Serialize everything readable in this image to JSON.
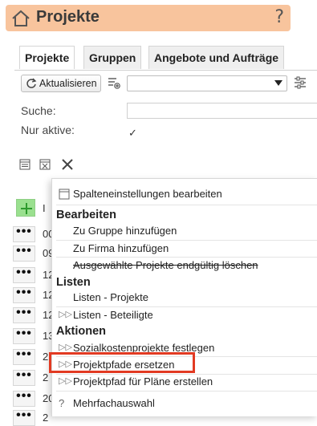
{
  "header": {
    "title": "Projekte",
    "help_glyph": "?"
  },
  "tabs": [
    {
      "label": "Projekte",
      "active": true
    },
    {
      "label": "Gruppen",
      "active": false
    },
    {
      "label": "Angebote und Aufträge",
      "active": false
    }
  ],
  "toolbar": {
    "refresh_label": "Aktualisieren",
    "select_value": ""
  },
  "filters": {
    "search_label": "Suche:",
    "search_value": "",
    "active_label": "Nur aktive:",
    "active_checked": "✓"
  },
  "list": {
    "rows": [
      {
        "dots": "•••",
        "text": "00"
      },
      {
        "dots": "•••",
        "text": "09"
      },
      {
        "dots": "•••",
        "text": "12"
      },
      {
        "dots": "•••",
        "text": "12"
      },
      {
        "dots": "•••",
        "text": "12"
      },
      {
        "dots": "•••",
        "text": "13"
      },
      {
        "dots": "•••",
        "text": "2"
      },
      {
        "dots": "•••",
        "text": "2"
      },
      {
        "dots": "•••",
        "text": "20"
      },
      {
        "dots": "•••",
        "text": "2"
      }
    ],
    "header_fragment": "I"
  },
  "menu": {
    "column_settings": "Spalteneinstellungen bearbeiten",
    "section_edit": "Bearbeiten",
    "add_to_group": "Zu Gruppe hinzufügen",
    "add_to_company": "Zu Firma hinzufügen",
    "delete_selected": "Ausgewählte Projekte endgültig löschen",
    "section_lists": "Listen",
    "list_projects": "Listen - Projekte",
    "list_participants": "Listen - Beteiligte",
    "section_actions": "Aktionen",
    "set_social_cost": "Sozialkostenprojekte festlegen",
    "replace_paths": "Projektpfade ersetzen",
    "create_plan_path": "Projektpfad für Pläne erstellen",
    "multi_select": "Mehrfachauswahl"
  },
  "colors": {
    "header_bg": "#f8c49d",
    "highlight": "#e23a22",
    "add_green": "#9ae08f"
  }
}
